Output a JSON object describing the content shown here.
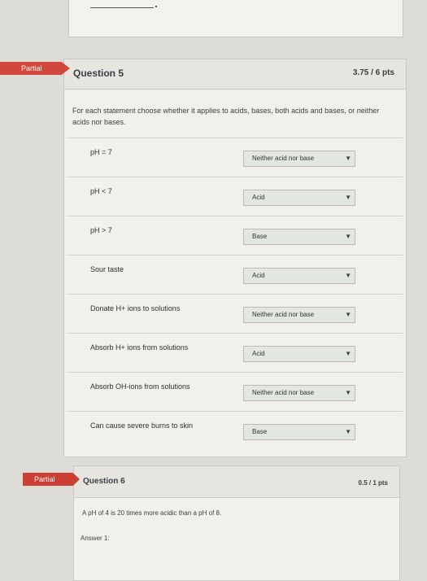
{
  "question5": {
    "badge": "Partial",
    "title": "Question 5",
    "points": "3.75 / 6 pts",
    "instructions": "For each statement choose whether it applies to acids, bases, both acids and bases, or neither acids nor bases.",
    "rows": [
      {
        "statement": "pH = 7",
        "selected": "Neither acid nor base"
      },
      {
        "statement": "pH < 7",
        "selected": "Acid"
      },
      {
        "statement": "pH > 7",
        "selected": "Base"
      },
      {
        "statement": "Sour taste",
        "selected": "Acid"
      },
      {
        "statement": "Donate H+ ions to solutions",
        "selected": "Neither acid nor base"
      },
      {
        "statement": "Absorb H+ ions from solutions",
        "selected": "Acid"
      },
      {
        "statement": "Absorb OH-ions from solutions",
        "selected": "Neither acid nor base"
      },
      {
        "statement": "Can cause severe burns to skin",
        "selected": "Base"
      }
    ]
  },
  "question6": {
    "badge": "Partial",
    "title": "Question 6",
    "points": "0.5 / 1 pts",
    "text": "A pH of 4 is 20 times more acidic than a pH of 8.",
    "answer_label": "Answer 1:"
  },
  "icons": {
    "dropdown": "chevron-down-icon"
  }
}
